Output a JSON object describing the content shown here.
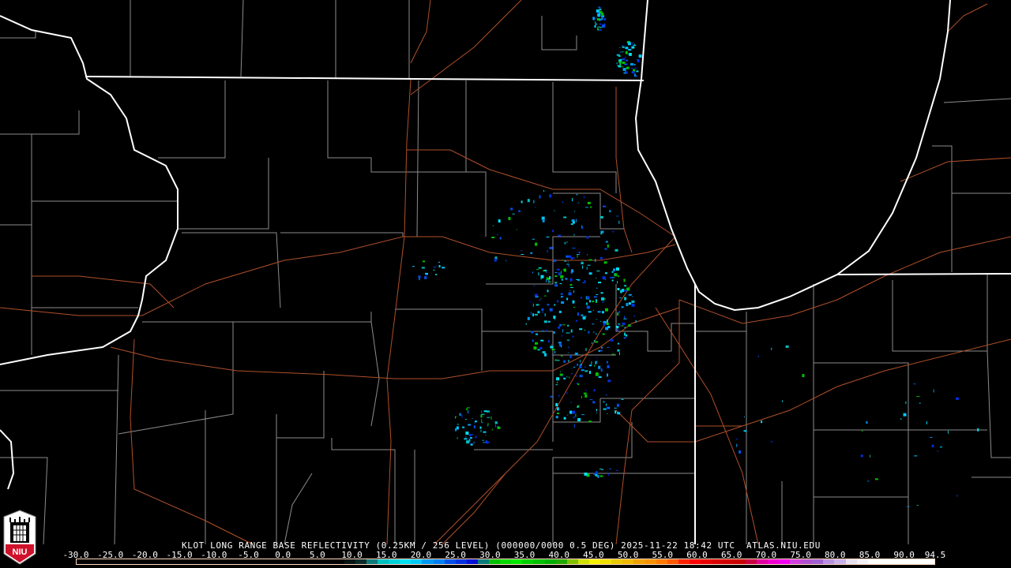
{
  "product": {
    "title": "KLOT LONG RANGE BASE REFLECTIVITY (0.25KM / 256 LEVEL) (000000/0000 0.5 DEG) 2025-11-22 18:42 UTC  ATLAS.NIU.EDU"
  },
  "logo": {
    "text": "NIU",
    "colors": {
      "shield": "#ffffff",
      "base": "#d0112b"
    }
  },
  "legend": {
    "units_min": -30.0,
    "units_max": 94.5,
    "ticks": [
      -30.0,
      -25.0,
      -20.0,
      -15.0,
      -10.0,
      -5.0,
      0.0,
      5.0,
      10.0,
      15.0,
      20.0,
      25.0,
      30.0,
      35.0,
      40.0,
      45.0,
      50.0,
      55.0,
      60.0,
      65.0,
      70.0,
      75.0,
      80.0,
      85.0,
      90.0,
      94.5
    ],
    "tick_labels": [
      "-30.0",
      "-25.0",
      "-20.0",
      "-15.0",
      "-10.0",
      "-5.0",
      "0.0",
      "5.0",
      "10.0",
      "15.0",
      "20.0",
      "25.0",
      "30.0",
      "35.0",
      "40.0",
      "45.0",
      "50.0",
      "55.0",
      "60.0",
      "65.0",
      "70.0",
      "75.0",
      "80.0",
      "85.0",
      "90.0",
      "94.5"
    ],
    "colors": [
      "#000000",
      "#000000",
      "#000000",
      "#000000",
      "#000000",
      "#000000",
      "#000000",
      "#000000",
      "#000000",
      "#000000",
      "#000000",
      "#000000",
      "#000000",
      "#000000",
      "#000000",
      "#000000",
      "#000000",
      "#000000",
      "#000000",
      "#000000",
      "#000000",
      "#000000",
      "#000000",
      "#000000",
      "#041414",
      "#0a2a2a",
      "#0e7a7a",
      "#00c0c0",
      "#00d0d8",
      "#00e0f0",
      "#00c8f8",
      "#0098f0",
      "#0080f0",
      "#0050e8",
      "#0030e0",
      "#0010d8",
      "#0a7a7a",
      "#00c000",
      "#00d800",
      "#00e800",
      "#00d000",
      "#00c000",
      "#00b000",
      "#20a800",
      "#80c000",
      "#d0e000",
      "#f8f000",
      "#f0e000",
      "#e8c800",
      "#f0b800",
      "#f0a000",
      "#f89000",
      "#ff7800",
      "#ff5800",
      "#ff2000",
      "#ff0000",
      "#e80000",
      "#d80000",
      "#d00000",
      "#c80000",
      "#c80040",
      "#e000a0",
      "#f000d0",
      "#f000f0",
      "#d040e0",
      "#b050d0",
      "#a060d0",
      "#b890e0",
      "#c8b0e8",
      "#e8e0f0",
      "#f4f0f8",
      "#ffffff",
      "#ffffff",
      "#ffffff",
      "#ffffff",
      "#ffffff",
      "#ffffff"
    ],
    "echo_colors": [
      "#00c8f8",
      "#0098f0",
      "#00e0f0",
      "#0050e8",
      "#00c0c0",
      "#0030e0",
      "#00c000"
    ]
  },
  "map_colors": {
    "state": "#ffffff",
    "county": "#9a9a9a",
    "road": "#b0502a"
  }
}
